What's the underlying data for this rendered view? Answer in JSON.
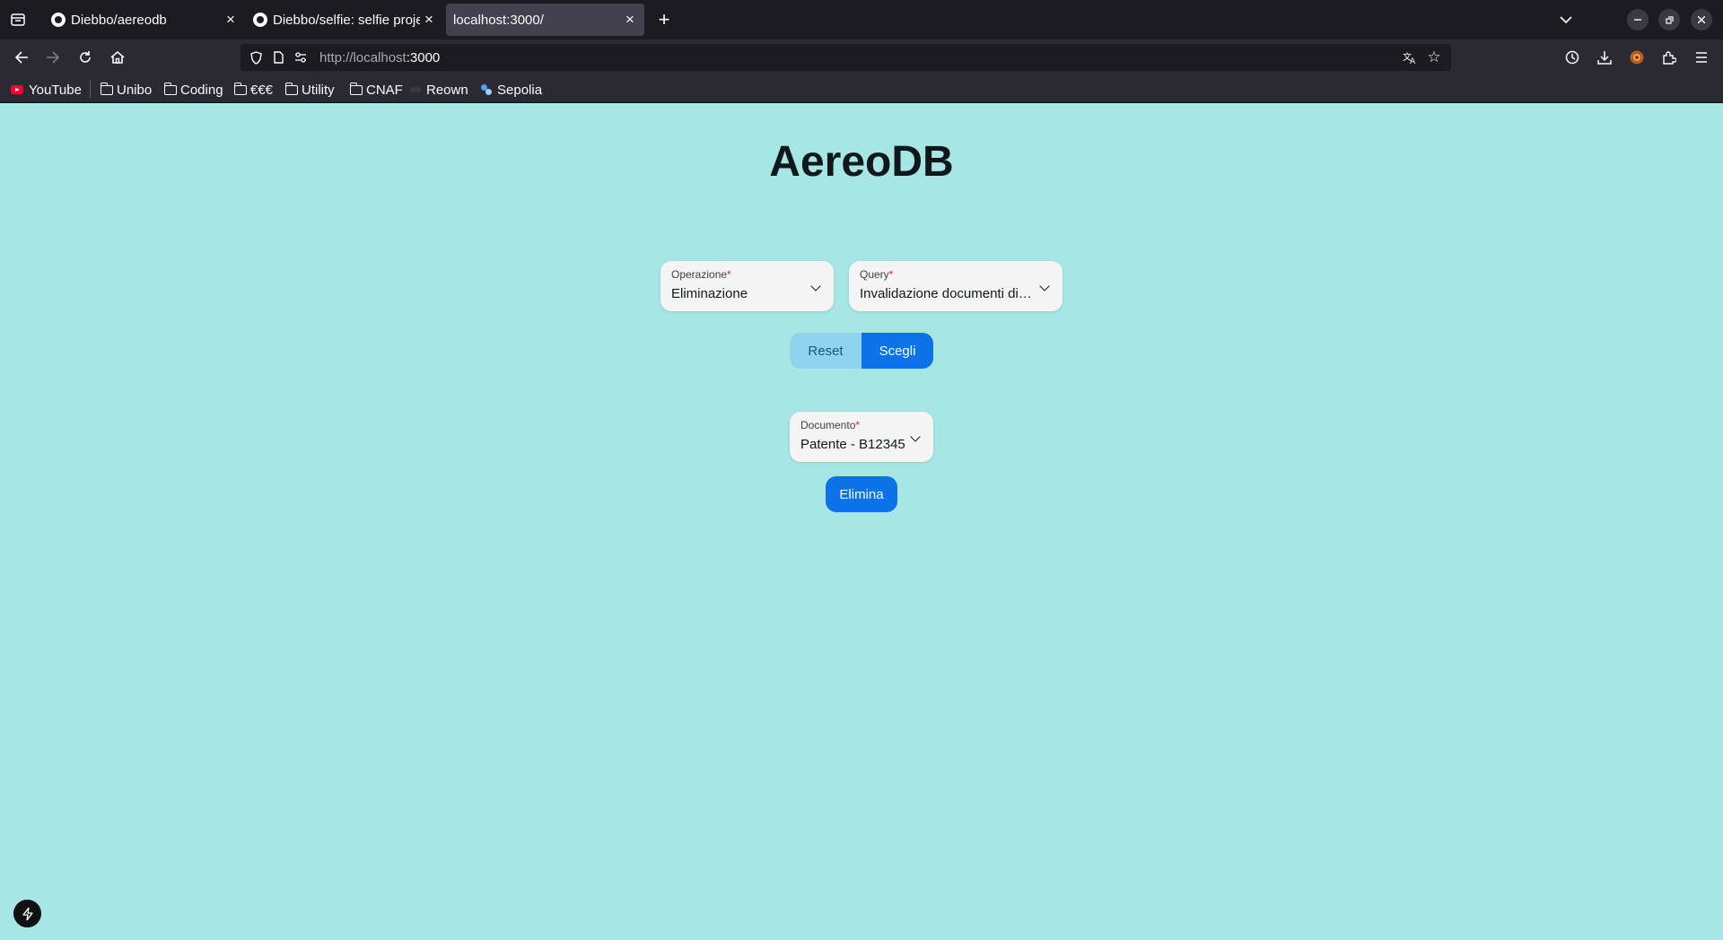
{
  "browser": {
    "tabs": [
      {
        "title": "Diebbo/aereodb",
        "icon": "github-icon",
        "active": false
      },
      {
        "title": "Diebbo/selfie: selfie project",
        "icon": "github-icon",
        "active": false
      },
      {
        "title": "localhost:3000/",
        "icon": "",
        "active": true
      }
    ],
    "url_host": "http://localhost",
    "url_port": ":3000",
    "bookmarks": [
      {
        "label": "YouTube",
        "icon": "youtube-icon"
      },
      {
        "label": "Unibo",
        "icon": "folder-icon"
      },
      {
        "label": "Coding",
        "icon": "folder-icon"
      },
      {
        "label": "€€€",
        "icon": "folder-icon"
      },
      {
        "label": "Utility",
        "icon": "folder-icon"
      },
      {
        "label": "CNAF",
        "icon": "folder-icon"
      },
      {
        "label": "Reown",
        "icon": "reown-icon"
      },
      {
        "label": "Sepolia",
        "icon": "sepolia-icon"
      }
    ]
  },
  "page": {
    "title": "AereoDB",
    "operazione": {
      "label": "Operazione",
      "required_mark": "*",
      "value": "Eliminazione"
    },
    "query": {
      "label": "Query",
      "required_mark": "*",
      "value": "Invalidazione documenti di i..."
    },
    "reset_label": "Reset",
    "scegli_label": "Scegli",
    "documento": {
      "label": "Documento",
      "required_mark": "*",
      "value": "Patente - B12345"
    },
    "elimina_label": "Elimina"
  },
  "colors": {
    "page_background": "#a6e6e4",
    "primary": "#0b72e7",
    "secondary": "#8fd3ef",
    "required": "#f31260"
  }
}
